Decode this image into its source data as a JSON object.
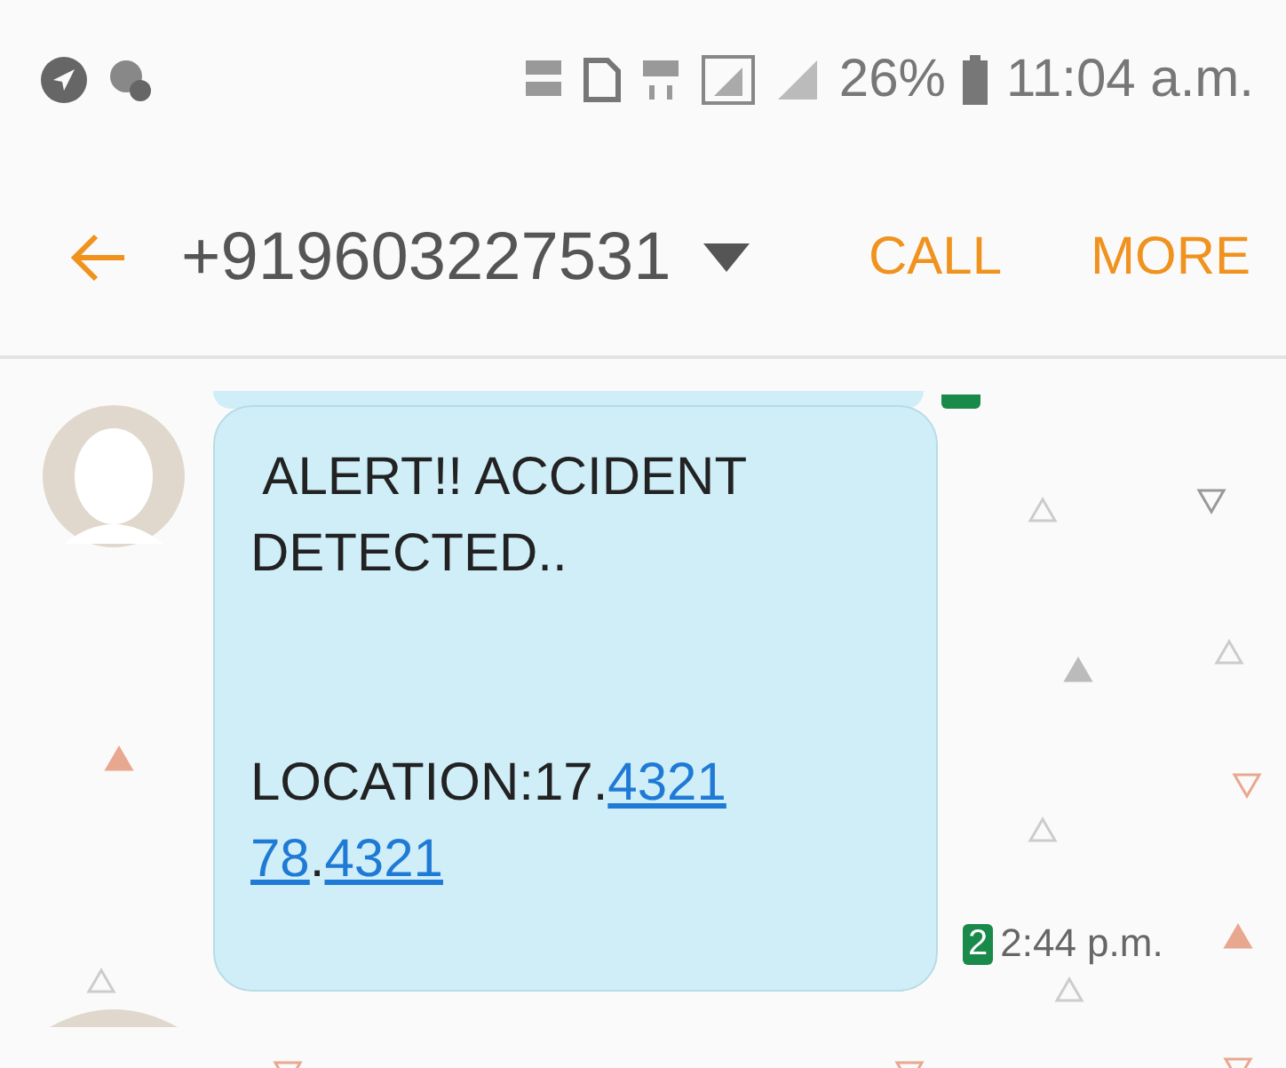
{
  "status_bar": {
    "battery": "26%",
    "time": "11:04 a.m."
  },
  "header": {
    "contact": "+919603227531",
    "actions": [
      "CALL",
      "MORE"
    ]
  },
  "message": {
    "paragraphs": [
      [
        [
          {
            "kind": "text",
            "text": " ALERT!! ACCIDENT"
          }
        ],
        [
          {
            "kind": "text",
            "text": "DETECTED.."
          }
        ]
      ],
      [
        [
          {
            "kind": "text",
            "text": "LOCATION:17."
          },
          {
            "kind": "link",
            "text": "4321"
          }
        ],
        [
          {
            "kind": "link",
            "text": "78"
          },
          {
            "kind": "text",
            "text": "."
          },
          {
            "kind": "link",
            "text": "4321"
          }
        ]
      ]
    ],
    "sim": "2",
    "time": "2:44 p.m."
  }
}
